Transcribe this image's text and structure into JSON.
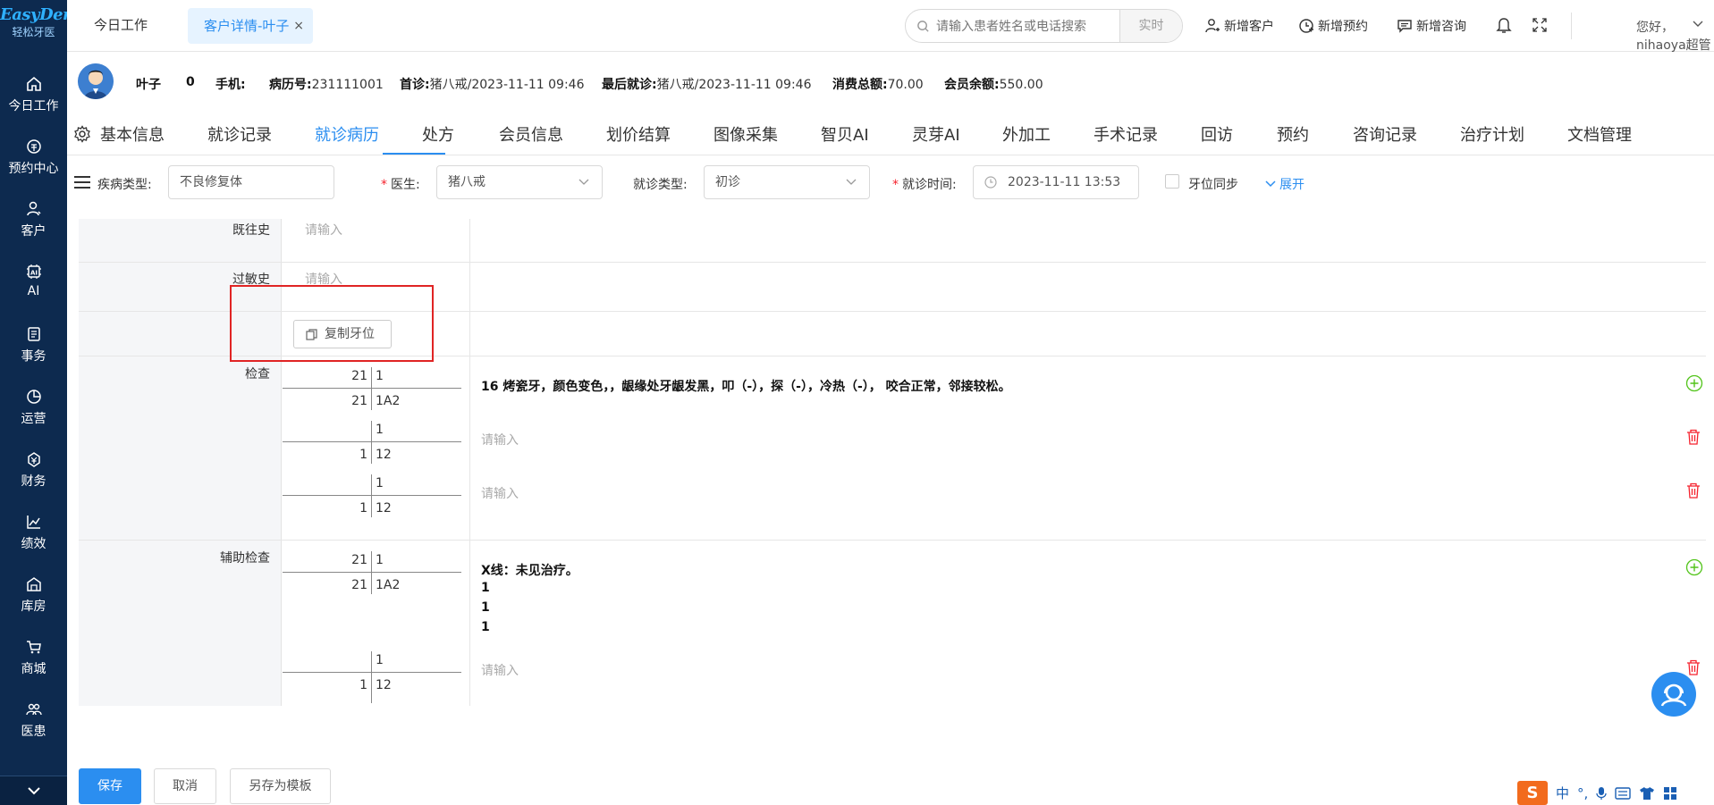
{
  "brand": {
    "logo_text": "EasyDent",
    "logo_sub": "轻松牙医"
  },
  "sidebar": {
    "items": [
      {
        "label": "今日工作",
        "icon": "home-icon"
      },
      {
        "label": "预约中心",
        "icon": "appointment-icon"
      },
      {
        "label": "客户",
        "icon": "user-icon"
      },
      {
        "label": "AI",
        "icon": "ai-chip-icon"
      },
      {
        "label": "事务",
        "icon": "task-icon"
      },
      {
        "label": "运营",
        "icon": "pie-chart-icon"
      },
      {
        "label": "财务",
        "icon": "money-icon"
      },
      {
        "label": "绩效",
        "icon": "trend-icon"
      },
      {
        "label": "库房",
        "icon": "warehouse-icon"
      },
      {
        "label": "商城",
        "icon": "cart-icon"
      },
      {
        "label": "医患",
        "icon": "doctor-patient-icon"
      }
    ]
  },
  "topbar": {
    "tab_today": "今日工作",
    "tab_active": "客户详情-叶子",
    "tab_close": "×",
    "search_placeholder": "请输入患者姓名或电话搜索",
    "realtime": "实时",
    "new_customer": "新增客户",
    "new_appointment": "新增预约",
    "new_consult": "新增咨询",
    "greeting": "您好，nihaoya超管"
  },
  "patient": {
    "name": "叶子",
    "age": "0",
    "phone_label": "手机:",
    "record_label": "病历号:",
    "record_no": "231111001",
    "first_visit_label": "首诊:",
    "first_visit": "猪八戒/2023-11-11 09:46",
    "last_visit_label": "最后就诊:",
    "last_visit": "猪八戒/2023-11-11 09:46",
    "total_label": "消费总额:",
    "total": "70.00",
    "balance_label": "会员余额:",
    "balance": "550.00"
  },
  "main_tabs": [
    "基本信息",
    "就诊记录",
    "就诊病历",
    "处方",
    "会员信息",
    "划价结算",
    "图像采集",
    "智贝AI",
    "灵芽AI",
    "外加工",
    "手术记录",
    "回访",
    "预约",
    "咨询记录",
    "治疗计划",
    "文档管理"
  ],
  "filters": {
    "disease_label": "疾病类型:",
    "disease_value": "不良修复体",
    "doctor_label": "医生:",
    "doctor_value": "猪八戒",
    "visit_type_label": "就诊类型:",
    "visit_type_value": "初诊",
    "visit_time_label": "就诊时间:",
    "visit_time_value": "2023-11-11 13:53",
    "tooth_sync": "牙位同步",
    "expand": "展开"
  },
  "form": {
    "past_history_label": "既往史",
    "allergy_label": "过敏史",
    "placeholder": "请输入",
    "copy_tooth": "复制牙位",
    "exam_label": "检查",
    "aux_exam_label": "辅助检查",
    "exam_rows": [
      {
        "ul": "21",
        "ur": "1",
        "ll": "21",
        "lr": "1A2",
        "text": "16 烤瓷牙，颜色变色，，龈缘处牙龈发黑，叩（-），探（-），冷热（-）， 咬合正常，邻接较松。"
      },
      {
        "ul": "",
        "ur": "1",
        "ll": "1",
        "lr": "12",
        "text": ""
      },
      {
        "ul": "",
        "ur": "1",
        "ll": "1",
        "lr": "12",
        "text": ""
      }
    ],
    "aux_rows": [
      {
        "ul": "21",
        "ur": "1",
        "ll": "21",
        "lr": "1A2",
        "text_lines": [
          "X线：未见治疗。",
          "1",
          "1",
          "1"
        ]
      },
      {
        "ul": "",
        "ur": "1",
        "ll": "1",
        "lr": "12",
        "text": ""
      }
    ]
  },
  "bottom": {
    "save": "保存",
    "cancel": "取消",
    "save_template": "另存为模板"
  },
  "ime": {
    "logo": "S",
    "lang": "中",
    "punct": "°,"
  },
  "colors": {
    "primary": "#2b8ef0",
    "sidebar": "#0d2a4f",
    "required": "#f5222d",
    "add": "#52c41a",
    "delete": "#f5222d"
  }
}
